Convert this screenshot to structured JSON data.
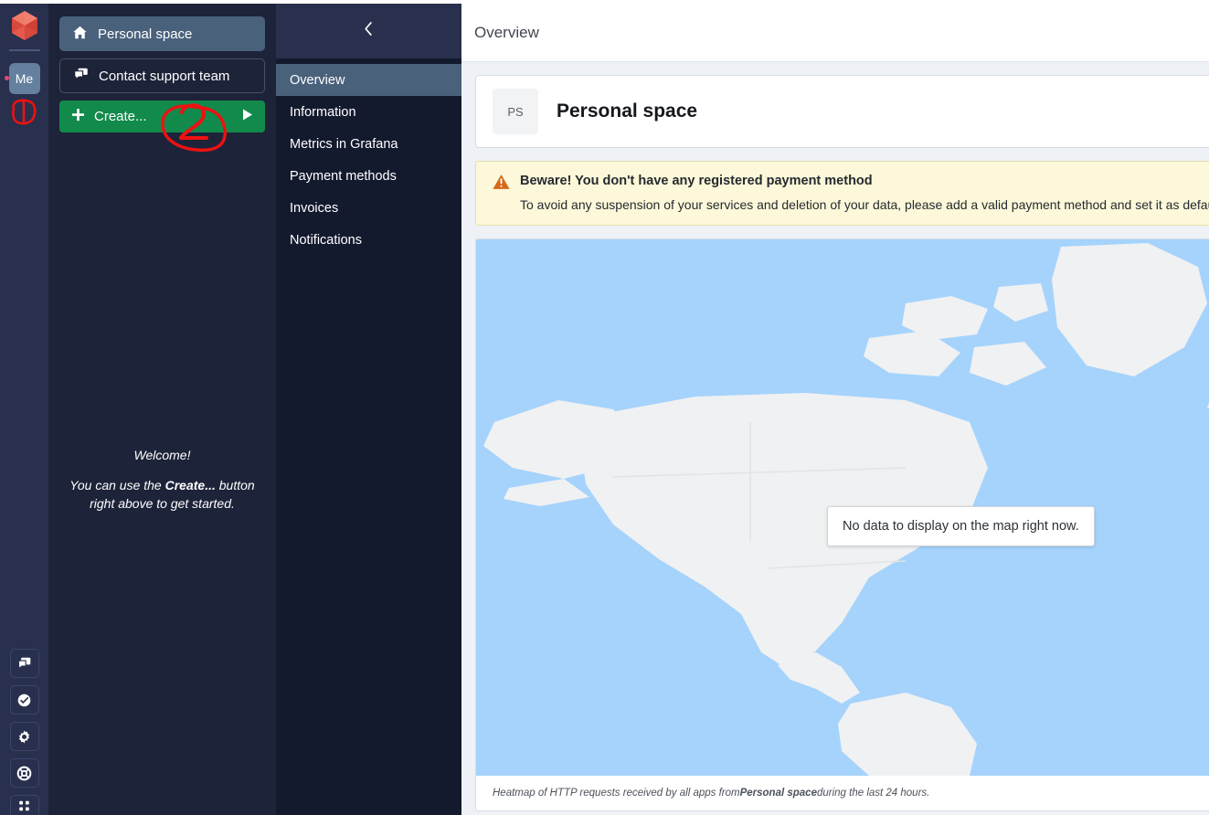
{
  "rail": {
    "logo_icon": "gem-logo-icon",
    "account": {
      "label": "Me",
      "badge_icon": "notification-dot-icon"
    },
    "bottom_buttons": [
      {
        "name": "chat-icon",
        "label": "Chat"
      },
      {
        "name": "check-circle-icon",
        "label": "Status"
      },
      {
        "name": "gear-icon",
        "label": "Settings"
      },
      {
        "name": "lifebuoy-icon",
        "label": "Help"
      },
      {
        "name": "grid-icon",
        "label": "Apps"
      }
    ]
  },
  "panel": {
    "space_button": {
      "label": "Personal space",
      "icon": "home-icon"
    },
    "support_button": {
      "label": "Contact support team",
      "icon": "chat-bubble-icon"
    },
    "create_button": {
      "label": "Create...",
      "icon": "plus-icon",
      "caret_icon": "caret-right-icon"
    },
    "welcome": {
      "title": "Welcome!",
      "line_pre": "You can use the ",
      "line_bold": "Create...",
      "line_post": " button right above to get started."
    },
    "annotations": [
      {
        "name": "red-blob-annotation",
        "text": ""
      },
      {
        "name": "red-number-annotation",
        "text": "2"
      }
    ]
  },
  "nav": {
    "collapse_icon": "chevron-left-icon",
    "items": [
      {
        "label": "Overview",
        "active": true
      },
      {
        "label": "Information",
        "active": false
      },
      {
        "label": "Metrics in Grafana",
        "active": false
      },
      {
        "label": "Payment methods",
        "active": false
      },
      {
        "label": "Invoices",
        "active": false
      },
      {
        "label": "Notifications",
        "active": false
      }
    ]
  },
  "main": {
    "header_title": "Overview",
    "space_card": {
      "initials": "PS",
      "name": "Personal space"
    },
    "alert": {
      "icon": "warning-triangle-icon",
      "title": "Beware! You don't have any registered payment method",
      "text": "To avoid any suspension of your services and deletion of your data, please add a valid payment method and set it as default."
    },
    "map": {
      "tooltip": "No data to display on the map right now.",
      "caption_pre": "Heatmap of HTTP requests received by all apps from ",
      "caption_bold": "Personal space",
      "caption_post": " during the last 24 hours."
    }
  },
  "colors": {
    "rail_bg": "#28304e",
    "panel_bg": "#1d2339",
    "nav_bg": "#141a2e",
    "nav_active": "#4a617c",
    "create_green": "#128a4c",
    "alert_yellow": "#fcf8d9",
    "map_ocean": "#a5d3fc",
    "map_land": "#f0f1f2",
    "annotation_red": "#ee1111"
  }
}
